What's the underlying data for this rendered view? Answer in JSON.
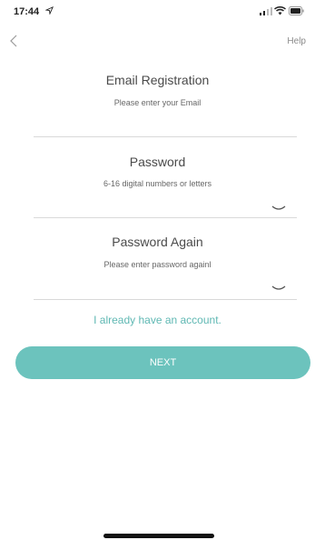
{
  "status_bar": {
    "time": "17:44",
    "icons": [
      "location-arrow-icon",
      "cellular-signal-icon",
      "wifi-icon",
      "battery-icon"
    ]
  },
  "nav": {
    "back_icon": "chevron-left-icon",
    "help_label": "Help"
  },
  "email_section": {
    "title": "Email Registration",
    "hint": "Please enter your Email",
    "value": ""
  },
  "password_section": {
    "title": "Password",
    "hint": "6-16 digital numbers or letters",
    "value": "",
    "toggle_icon": "eye-closed-icon"
  },
  "password_again_section": {
    "title": "Password Again",
    "hint": "Please enter password againl",
    "value": "",
    "toggle_icon": "eye-closed-icon"
  },
  "login_link": "I already have an account.",
  "next_label": "NEXT",
  "colors": {
    "accent": "#6cc3bd",
    "link": "#5fb8b3",
    "text": "#4a4a4a",
    "divider": "#d9d9d9"
  }
}
